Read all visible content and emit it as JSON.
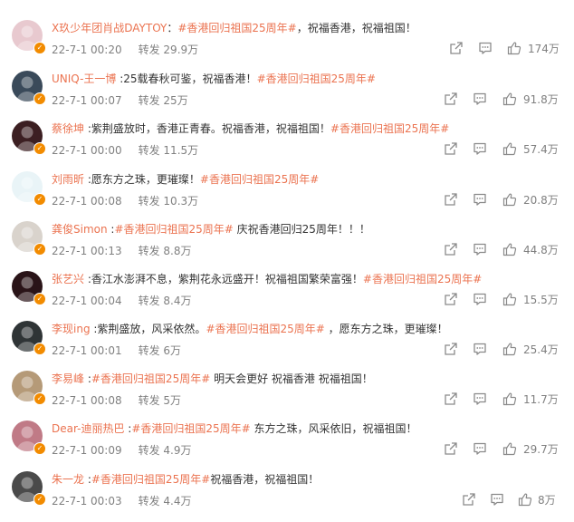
{
  "comments": [
    {
      "user": "X玖少年团肖战DAYTOY",
      "sep": "：",
      "pre": "",
      "tag": "#香港回归祖国25周年#",
      "post": "，祝福香港，祝福祖国！",
      "date": "22-7-1 00:20",
      "repost": "转发 29.9万",
      "likes": "174万",
      "avatar_color": "#e8c9cf"
    },
    {
      "user": "UNIQ-王一博",
      "sep": " :",
      "pre": "25载春秋可鉴，祝福香港！",
      "tag": "#香港回归祖国25周年#",
      "post": "",
      "date": "22-7-1 00:07",
      "repost": "转发 25万",
      "likes": "91.8万",
      "avatar_color": "#3a4a5a"
    },
    {
      "user": "蔡徐坤",
      "sep": " :",
      "pre": "紫荆盛放时，香港正青春。祝福香港，祝福祖国！",
      "tag": "#香港回归祖国25周年#",
      "post": "",
      "date": "22-7-1 00:00",
      "repost": "转发 11.5万",
      "likes": "57.4万",
      "avatar_color": "#3c1f22"
    },
    {
      "user": "刘雨昕",
      "sep": " :",
      "pre": "愿东方之珠，更璀璨！",
      "tag": "#香港回归祖国25周年#",
      "post": "",
      "date": "22-7-1 00:08",
      "repost": "转发 10.3万",
      "likes": "20.8万",
      "avatar_color": "#e9f4f7"
    },
    {
      "user": "龚俊Simon",
      "sep": " :",
      "pre": "",
      "tag": "#香港回归祖国25周年#",
      "post": " 庆祝香港回归25周年！！！",
      "date": "22-7-1 00:13",
      "repost": "转发 8.8万",
      "likes": "44.8万",
      "avatar_color": "#d9d3cc"
    },
    {
      "user": "张艺兴",
      "sep": " :",
      "pre": "香江水澎湃不息，紫荆花永远盛开！祝福祖国繁荣富强！",
      "tag": "#香港回归祖国25周年#",
      "post": "",
      "date": "22-7-1 00:04",
      "repost": "转发 8.4万",
      "likes": "15.5万",
      "avatar_color": "#2a1418"
    },
    {
      "user": "李现ing",
      "sep": " :",
      "pre": "紫荆盛放，风采依然。",
      "tag": "#香港回归祖国25周年#",
      "post": " ，愿东方之珠，更璀璨！",
      "date": "22-7-1 00:01",
      "repost": "转发 6万",
      "likes": "25.4万",
      "avatar_color": "#2f3436"
    },
    {
      "user": "李易峰",
      "sep": " :",
      "pre": "",
      "tag": "#香港回归祖国25周年#",
      "post": " 明天会更好 祝福香港 祝福祖国！",
      "date": "22-7-1 00:08",
      "repost": "转发 5万",
      "likes": "11.7万",
      "avatar_color": "#b59a78"
    },
    {
      "user": "Dear-迪丽热巴",
      "sep": " :",
      "pre": "",
      "tag": "#香港回归祖国25周年#",
      "post": " 东方之珠，风采依旧，祝福祖国！",
      "date": "22-7-1 00:09",
      "repost": "转发 4.9万",
      "likes": "29.7万",
      "avatar_color": "#c07a86"
    },
    {
      "user": "朱一龙",
      "sep": " :",
      "pre": "",
      "tag": "#香港回归祖国25周年#",
      "post": "祝福香港，祝福祖国！",
      "date": "22-7-1 00:03",
      "repost": "转发 4.4万",
      "likes": "8万",
      "avatar_color": "#4a4a4a"
    }
  ],
  "colors": {
    "link": "#eb7350",
    "meta": "#808080",
    "badge": "#f28b00"
  },
  "icons": {
    "share": "share-icon",
    "comment": "comment-icon",
    "like": "thumbs-up-icon",
    "verified": "verified-badge-icon"
  }
}
